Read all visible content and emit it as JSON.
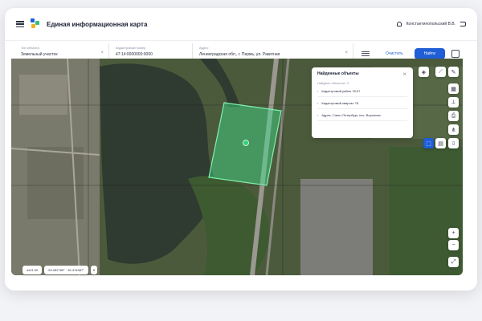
{
  "header": {
    "title": "Единая информационная карта",
    "user_name": "Константинопольский В.В."
  },
  "filters": {
    "fields": [
      {
        "label": "Тип объекта",
        "value": "Земельный участок"
      },
      {
        "label": "Кадастровый номер",
        "value": "47:14:0000000:0000"
      },
      {
        "label": "Адрес",
        "value": "Ленинградская обл., г. Пермь, ул. Ракитная"
      }
    ],
    "clear_label": "Очистить",
    "find_label": "Найти"
  },
  "results": {
    "title": "Найденные объекты",
    "subtitle": "Найдено объектов: 3",
    "items": [
      "Кадастровый район 78:07",
      "Кадастровый квартал 78",
      "Адрес: Санкт-Петербург, пос. Вороново"
    ]
  },
  "status": {
    "zoom": "4x01:00",
    "coordinates": "59.282789° · 30.474987°"
  },
  "colors": {
    "accent": "#1f5ed6",
    "parcel_fill": "#3fe08a",
    "parcel_stroke": "#7ff2b0"
  }
}
